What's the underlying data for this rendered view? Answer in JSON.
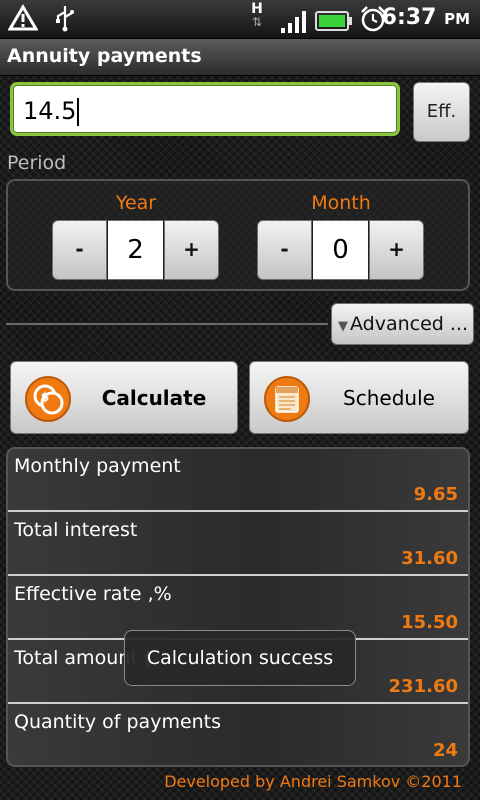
{
  "status_bar": {
    "time": "6:37",
    "ampm": "PM",
    "network": "H",
    "icons": [
      "warning-icon",
      "usb-icon",
      "network-h-icon",
      "signal-icon",
      "battery-icon",
      "alarm-icon"
    ]
  },
  "title": "Annuity payments",
  "rate_input": {
    "value": "14.5"
  },
  "eff_button": "Eff.",
  "period": {
    "label": "Period",
    "year": {
      "title": "Year",
      "value": "2",
      "minus": "-",
      "plus": "+"
    },
    "month": {
      "title": "Month",
      "value": "0",
      "minus": "-",
      "plus": "+"
    }
  },
  "advanced_button": "Advanced ...",
  "buttons": {
    "calculate": "Calculate",
    "schedule": "Schedule"
  },
  "results": [
    {
      "label": "Monthly payment",
      "value": "9.65"
    },
    {
      "label": "Total interest",
      "value": "31.60"
    },
    {
      "label": "Effective rate ,%",
      "value": "15.50"
    },
    {
      "label": "Total amount (",
      "value": "231.60"
    },
    {
      "label": "Quantity of payments",
      "value": "24"
    }
  ],
  "toast": "Calculation success",
  "footer": "Developed by Andrei Samkov ©2011",
  "colors": {
    "accent": "#f07a12",
    "input_border": "#8ac53e",
    "battery": "#3cd23c"
  }
}
